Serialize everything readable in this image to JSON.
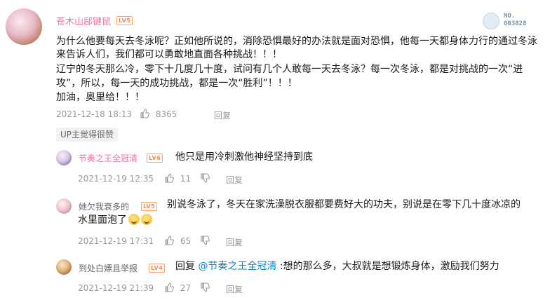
{
  "main_comment": {
    "username": "苍木山郈键鼠",
    "level": "LV5",
    "badge": {
      "line1": "NO.",
      "line2": "003828"
    },
    "lines": [
      "为什么他要每天去冬泳呢？正如他所说的，消除恐惧最好的办法就是面对恐惧，他每一天都身体力行的通过冬泳",
      "来告诉人们，我们都可以勇敢地直面各种挑战！！！",
      "辽宁的冬天那么冷，零下十几度几十度，试问有几个人敢每一天去冬泳？每一次冬泳，都是对挑战的一次“进",
      "攻”，所以，每一天的成功挑战，都是一次“胜利”！！！",
      "加油，奥里给！！！"
    ],
    "time": "2021-12-18 18:13",
    "likes": "8365",
    "reply_label": "回复",
    "up_tag": "UP主觉得很赞"
  },
  "replies": [
    {
      "username": "节奏之王全冠清",
      "level": "LV6",
      "text": "他只是用冷刺激他神经坚持到底",
      "time": "2021-12-19 12:35",
      "likes": "11",
      "reply_label": "回复"
    },
    {
      "username": "她欠我衰多的",
      "level": "LV5",
      "text_line1": "别说冬泳了，冬天在家洗澡脱衣服都要费好大的功夫，别说是在零下几十度冰凉的",
      "text_line2": "水里面泡了",
      "time": "2021-12-19 17:31",
      "likes": "65",
      "reply_label": "回复"
    },
    {
      "username": "到处白嫖且举报",
      "level": "LV4",
      "prefix": "回复 ",
      "mention": "@节奏之王全冠清",
      "text": " :想的那么多，大叔就是想锻炼身体，激励我们努力",
      "time": "2021-12-19 21:39",
      "likes": "27",
      "reply_label": "回复"
    }
  ],
  "colors": {
    "username": "#fb7299",
    "meta": "#9499a0",
    "mention": "#008ac5",
    "level": "#ff8a4a"
  }
}
